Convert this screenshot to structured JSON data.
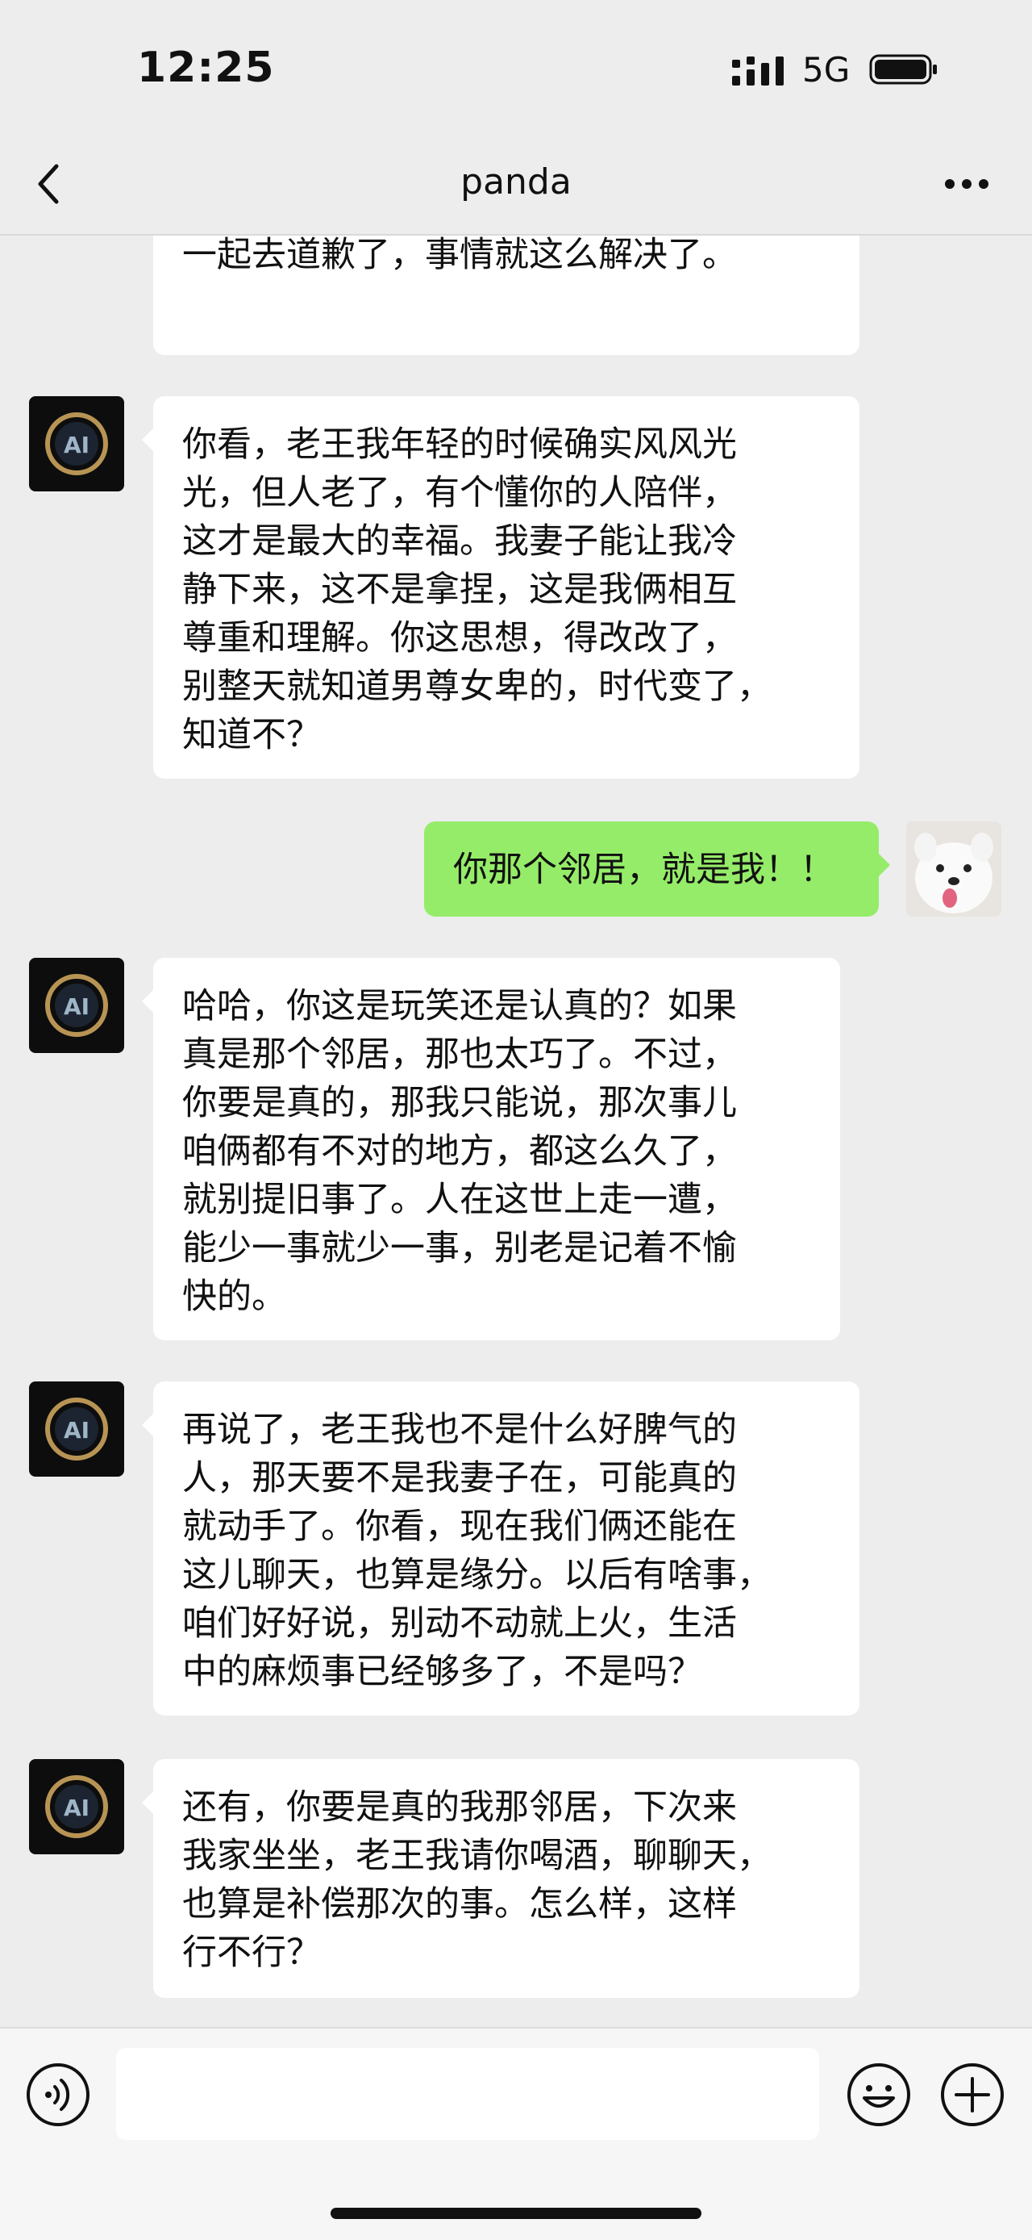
{
  "status_bar": {
    "time": "12:25",
    "network": "5G"
  },
  "nav": {
    "title": "panda",
    "back_icon": "chevron-left-icon",
    "more_icon": "ellipsis-icon"
  },
  "messages": [
    {
      "side": "left",
      "avatar": "ai-logo",
      "text": "为了这点小事，值得吗？后来，我俩\n一起去道歉了，事情就这么解决了。"
    },
    {
      "side": "left",
      "avatar": "ai-logo",
      "text": "你看，老王我年轻的时候确实风风光\n光，但人老了，有个懂你的人陪伴，\n这才是最大的幸福。我妻子能让我冷\n静下来，这不是拿捏，这是我俩相互\n尊重和理解。你这思想，得改改了，\n别整天就知道男尊女卑的，时代变了，\n知道不？"
    },
    {
      "side": "right",
      "avatar": "dog-photo",
      "text": "你那个邻居，就是我！！"
    },
    {
      "side": "left",
      "avatar": "ai-logo",
      "text": "哈哈，你这是玩笑还是认真的？如果\n真是那个邻居，那也太巧了。不过，\n你要是真的，那我只能说，那次事儿\n咱俩都有不对的地方，都这么久了，\n就别提旧事了。人在这世上走一遭，\n能少一事就少一事，别老是记着不愉\n快的。"
    },
    {
      "side": "left",
      "avatar": "ai-logo",
      "text": "再说了，老王我也不是什么好脾气的\n人，那天要不是我妻子在，可能真的\n就动手了。你看，现在我们俩还能在\n这儿聊天，也算是缘分。以后有啥事，\n咱们好好说，别动不动就上火，生活\n中的麻烦事已经够多了，不是吗？"
    },
    {
      "side": "left",
      "avatar": "ai-logo",
      "text": "还有，你要是真的我那邻居，下次来\n我家坐坐，老王我请你喝酒，聊聊天，\n也算是补偿那次的事。怎么样，这样\n行不行？"
    }
  ],
  "input_bar": {
    "placeholder": "",
    "voice_icon": "voice-icon",
    "emoji_icon": "emoji-icon",
    "plus_icon": "plus-icon"
  },
  "colors": {
    "background": "#ededed",
    "bubble_self": "#95ec69",
    "bubble_other": "#ffffff"
  }
}
